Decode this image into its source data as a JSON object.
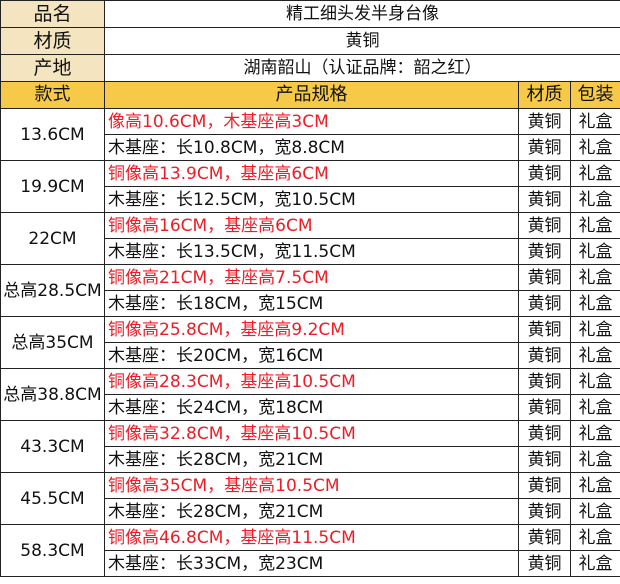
{
  "info": {
    "name_label": "品名",
    "name_value": "精工细头发半身台像",
    "material_label": "材质",
    "material_value": "黄铜",
    "origin_label": "产地",
    "origin_value": "湖南韶山（认证品牌：韶之红）"
  },
  "header": {
    "style": "款式",
    "spec": "产品规格",
    "material": "材质",
    "package": "包装"
  },
  "rows": [
    {
      "style": "13.6CM",
      "spec1": "像高10.6CM，木基座高3CM",
      "spec2": "木基座：长10.8CM，宽8.8CM",
      "material": "黄铜",
      "package": "礼盒"
    },
    {
      "style": "19.9CM",
      "spec1": "铜像高13.9CM，基座高6CM",
      "spec2": "木基座：长12.5CM，宽10.5CM",
      "material": "黄铜",
      "package": "礼盒"
    },
    {
      "style": "22CM",
      "spec1": "铜像高16CM，基座高6CM",
      "spec2": "木基座：长13.5CM，宽11.5CM",
      "material": "黄铜",
      "package": "礼盒"
    },
    {
      "style": "总高28.5CM",
      "spec1": "铜像高21CM，基座高7.5CM",
      "spec2": "木基座：长18CM，宽15CM",
      "material": "黄铜",
      "package": "礼盒"
    },
    {
      "style": "总高35CM",
      "spec1": "铜像高25.8CM，基座高9.2CM",
      "spec2": "木基座：长20CM，宽16CM",
      "material": "黄铜",
      "package": "礼盒"
    },
    {
      "style": "总高38.8CM",
      "spec1": "铜像高28.3CM，基座高10.5CM",
      "spec2": "木基座：长24CM，宽18CM",
      "material": "黄铜",
      "package": "礼盒"
    },
    {
      "style": "43.3CM",
      "spec1": "铜像高32.8CM，基座高10.5CM",
      "spec2": "木基座：长28CM，宽21CM",
      "material": "黄铜",
      "package": "礼盒"
    },
    {
      "style": "45.5CM",
      "spec1": "铜像高35CM，基座高10.5CM",
      "spec2": "木基座：长28CM，宽21CM",
      "material": "黄铜",
      "package": "礼盒"
    },
    {
      "style": "58.3CM",
      "spec1": "铜像高46.8CM，基座高11.5CM",
      "spec2": "木基座：长33CM，宽23CM",
      "material": "黄铜",
      "package": "礼盒"
    }
  ],
  "colors": {
    "header_bg": "#f7c948",
    "label_bg": "#f4e5c0",
    "spec_highlight": "#ee1c24"
  }
}
